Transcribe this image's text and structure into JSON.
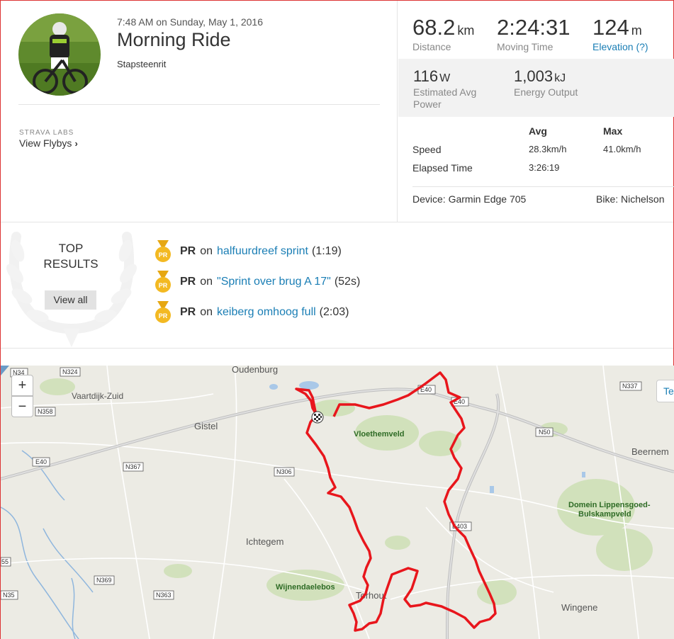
{
  "activity": {
    "date": "7:48 AM on Sunday, May 1, 2016",
    "title": "Morning Ride",
    "description": "Stapsteenrit"
  },
  "labs": {
    "label": "STRAVA LABS",
    "flybys": "View Flybys",
    "chevron": "›"
  },
  "stats": {
    "distance": {
      "value": "68.2",
      "unit": "km",
      "label": "Distance"
    },
    "moving_time": {
      "value": "2:24:31",
      "label": "Moving Time"
    },
    "elevation": {
      "value": "124",
      "unit": "m",
      "label": "Elevation (?)"
    },
    "power": {
      "value": "116",
      "unit": "W",
      "label_line1": "Estimated Avg",
      "label_line2": "Power"
    },
    "energy": {
      "value": "1,003",
      "unit": "kJ",
      "label": "Energy Output"
    },
    "table": {
      "avg_header": "Avg",
      "max_header": "Max",
      "speed_label": "Speed",
      "speed_avg": "28.3km/h",
      "speed_max": "41.0km/h",
      "elapsed_label": "Elapsed Time",
      "elapsed_avg": "3:26:19"
    },
    "device": "Device: Garmin Edge 705",
    "bike": "Bike: Nichelson"
  },
  "results": {
    "heading_line1": "TOP",
    "heading_line2": "RESULTS",
    "view_all": "View all",
    "items": [
      {
        "badge": "PR",
        "on": "on",
        "segment": "halfuurdreef sprint",
        "time": "(1:19)"
      },
      {
        "badge": "PR",
        "on": "on",
        "segment": "\"Sprint over brug A 17\"",
        "time": "(52s)"
      },
      {
        "badge": "PR",
        "on": "on",
        "segment": "keiberg omhoog full",
        "time": "(2:03)"
      }
    ]
  },
  "map": {
    "zoom_in": "+",
    "zoom_out": "−",
    "terrain_tab": "Te",
    "places": [
      "Oudenburg",
      "Gistel",
      "Vloethemveld",
      "Beernem",
      "Ichtegem",
      "Domein Lippensgoed-",
      "Bulskampveld",
      "Wijnendaelebos",
      "Torhout",
      "Wingene",
      "Vaartdijk-Zuid"
    ],
    "roads": [
      "N34",
      "N324",
      "N358",
      "E40",
      "N367",
      "N306",
      "N369",
      "N363",
      "N35",
      "55",
      "N337",
      "N50",
      "E403",
      "E40"
    ]
  },
  "colors": {
    "accent_link": "#1a7eb5",
    "route": "#e8161c",
    "medal": "#f3b922"
  }
}
